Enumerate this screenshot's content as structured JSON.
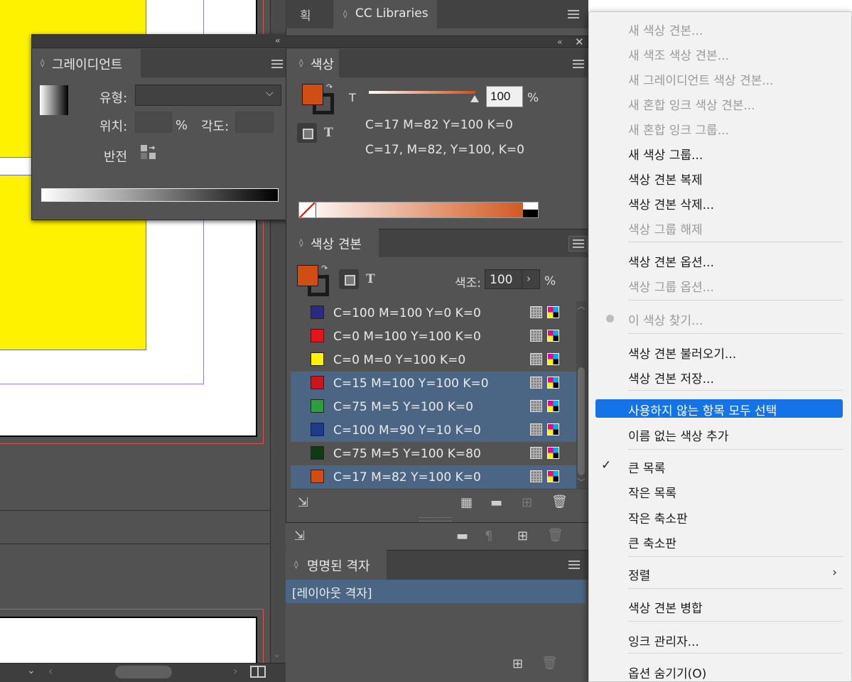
{
  "canvas": {
    "yellow": "#fff200",
    "scroll": {
      "left": "‹",
      "right": "›",
      "down": "⌄"
    }
  },
  "gradient_panel": {
    "tab_label": "그레이디언트",
    "type_label": "유형:",
    "type_value": "",
    "position_label": "위치:",
    "position_value": "",
    "position_unit": "%",
    "angle_label": "각도:",
    "angle_value": "",
    "reverse_label": "반전"
  },
  "dock": {
    "top_tab_1": "획",
    "top_tab_2": "CC Libraries"
  },
  "color_panel": {
    "tab_label": "색상",
    "fill_color": "#d04e14",
    "tint_label": "T",
    "tint_value": "100",
    "tint_unit": "%",
    "swatch_name": "C=17 M=82 Y=100 K=0",
    "cmyk_readout": "C=17, M=82, Y=100, K=0"
  },
  "swatches_panel": {
    "tab_label": "색상 견본",
    "tint_label": "색조:",
    "tint_value": "100",
    "tint_unit": "%",
    "items": [
      {
        "name": "C=100 M=100 Y=0 K=0",
        "color": "#2a2a85",
        "selected": false
      },
      {
        "name": "C=0 M=100 Y=100 K=0",
        "color": "#e3141b",
        "selected": false
      },
      {
        "name": "C=0 M=0 Y=100 K=0",
        "color": "#fff200",
        "selected": false
      },
      {
        "name": "C=15 M=100 Y=100 K=0",
        "color": "#c8161d",
        "selected": true
      },
      {
        "name": "C=75 M=5 Y=100 K=0",
        "color": "#2e9e3a",
        "selected": true
      },
      {
        "name": "C=100 M=90 Y=10 K=0",
        "color": "#1f3a8a",
        "selected": true
      },
      {
        "name": "C=75 M=5 Y=100 K=80",
        "color": "#0f3a12",
        "selected": false
      },
      {
        "name": "C=17 M=82 Y=100 K=0",
        "color": "#d04e14",
        "selected": true
      }
    ]
  },
  "named_grids_panel": {
    "tab_label": "명명된 격자",
    "items": [
      "[레이아웃 격자]"
    ]
  },
  "context_menu": {
    "items": [
      {
        "label": "새 색상 견본...",
        "disabled": true
      },
      {
        "label": "새 색조 색상 견본...",
        "disabled": true
      },
      {
        "label": "새 그레이디언트 색상 견본...",
        "disabled": true
      },
      {
        "label": "새 혼합 잉크 색상 견본...",
        "disabled": true
      },
      {
        "label": "새 혼합 잉크 그룹...",
        "disabled": true
      },
      {
        "label": "새 색상 그룹...",
        "disabled": false
      },
      {
        "label": "색상 견본 복제",
        "disabled": false
      },
      {
        "label": "색상 견본 삭제...",
        "disabled": false
      },
      {
        "label": "색상 그룹 해제",
        "disabled": true
      },
      {
        "label": "색상 견본 옵션...",
        "disabled": false
      },
      {
        "label": "색상 그룹 옵션...",
        "disabled": true
      },
      {
        "label": "이 색상 찾기...",
        "disabled": true
      },
      {
        "label": "색상 견본 불러오기...",
        "disabled": false
      },
      {
        "label": "색상 견본 저장...",
        "disabled": false
      },
      {
        "label": "사용하지 않는 항목 모두 선택",
        "disabled": false,
        "highlighted": true
      },
      {
        "label": "이름 없는 색상 추가",
        "disabled": false
      },
      {
        "label": "큰 목록",
        "disabled": false,
        "checked": true
      },
      {
        "label": "작은 목록",
        "disabled": false
      },
      {
        "label": "작은 축소판",
        "disabled": false
      },
      {
        "label": "큰 축소판",
        "disabled": false
      },
      {
        "label": "정렬",
        "disabled": false,
        "submenu": true
      },
      {
        "label": "색상 견본 병합",
        "disabled": false
      },
      {
        "label": "잉크 관리자...",
        "disabled": false
      },
      {
        "label": "옵션 숨기기(O)",
        "disabled": false
      }
    ]
  },
  "icons": {
    "menu": "panel-menu-icon",
    "collapse": "collapse-icon",
    "close": "close-icon",
    "check": "✓",
    "submenu": "›",
    "chevron": "⌵"
  }
}
